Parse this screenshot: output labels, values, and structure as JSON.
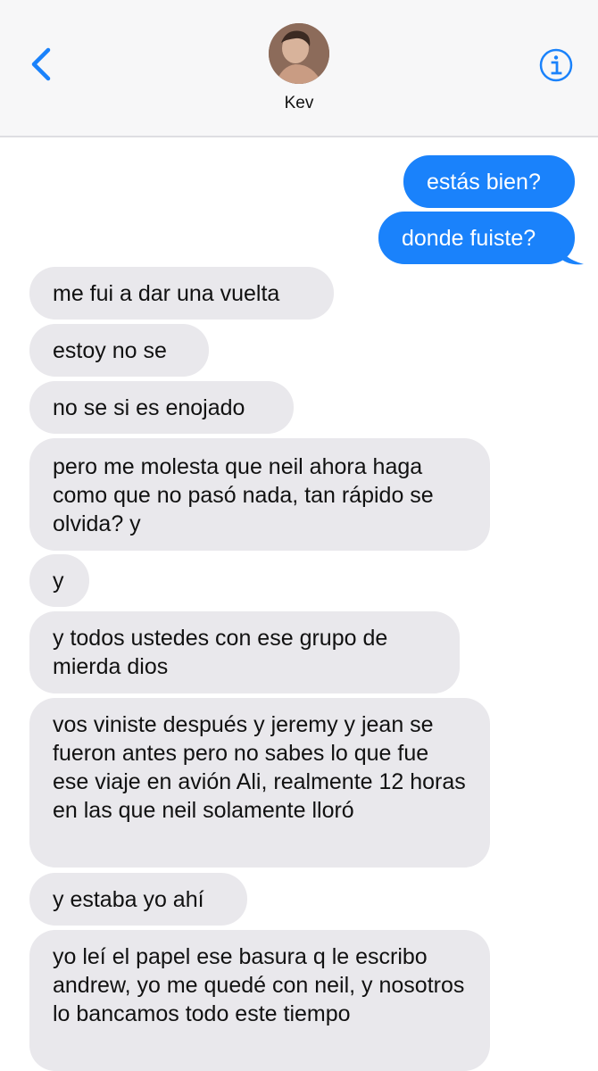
{
  "header": {
    "contact_name": "Kev",
    "back_icon": "chevron-left-icon",
    "info_icon": "info-icon",
    "accent_color": "#1a82fb"
  },
  "messages": [
    {
      "from": "me",
      "text": "estás bien?"
    },
    {
      "from": "me",
      "text": "donde fuiste?"
    },
    {
      "from": "them",
      "text": "me fui a dar una vuelta"
    },
    {
      "from": "them",
      "text": "estoy no se"
    },
    {
      "from": "them",
      "text": "no se si es enojado"
    },
    {
      "from": "them",
      "text": "pero me molesta que neil ahora haga como que no pasó nada, tan rápido se olvida? y"
    },
    {
      "from": "them",
      "text": "y"
    },
    {
      "from": "them",
      "text": "y todos ustedes con ese grupo de mierda dios"
    },
    {
      "from": "them",
      "text": "vos viniste después y jeremy y jean se fueron antes pero no sabes lo que fue ese viaje en avión Ali, realmente 12 horas en las que neil solamente lloró"
    },
    {
      "from": "them",
      "text": "y estaba yo ahí"
    },
    {
      "from": "them",
      "text": "yo leí el papel ese basura q le escribo andrew, yo me quedé con neil, y nosotros lo bancamos todo este tiempo"
    }
  ]
}
